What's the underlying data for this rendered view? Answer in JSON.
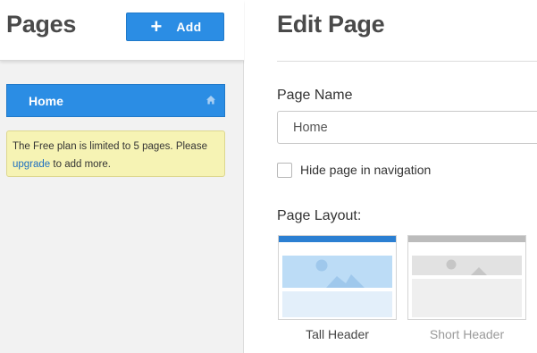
{
  "left_panel": {
    "title": "Pages",
    "add_button": {
      "icon": "plus-icon",
      "label": "Add"
    },
    "pages": [
      {
        "label": "Home",
        "icon": "home-icon",
        "selected": true
      }
    ],
    "notice": {
      "text_before": "The Free plan is limited to 5 pages. Please ",
      "link_text": "upgrade",
      "text_after": " to add more."
    }
  },
  "editor": {
    "title": "Edit Page",
    "page_name": {
      "label": "Page Name",
      "value": "Home"
    },
    "hide_nav": {
      "label": "Hide page in navigation",
      "checked": false
    },
    "layout": {
      "label": "Page Layout:",
      "options": [
        {
          "label": "Tall Header",
          "selected": true
        },
        {
          "label": "Short Header",
          "selected": false
        }
      ]
    }
  },
  "colors": {
    "accent": "#2b8de4",
    "notice_bg": "#f6f3b4",
    "link": "#1f6fc0"
  }
}
